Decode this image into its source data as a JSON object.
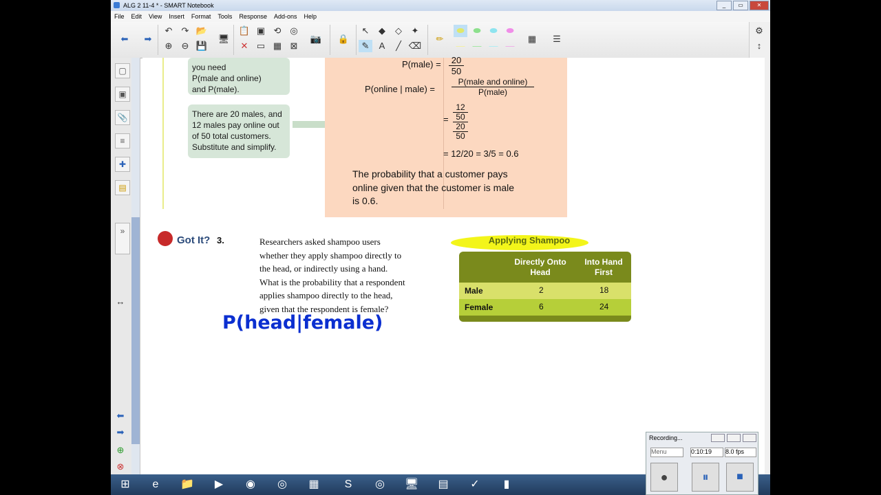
{
  "window": {
    "title": "ALG 2 11-4 * - SMART Notebook"
  },
  "menu": [
    "File",
    "Edit",
    "View",
    "Insert",
    "Format",
    "Tools",
    "Response",
    "Add-ons",
    "Help"
  ],
  "lesson": {
    "box1_text": [
      "you need",
      "P(male and online)",
      "and P(male)."
    ],
    "box2_text": [
      "There are 20 males, and",
      "12 males pay online out",
      "of 50 total customers.",
      "Substitute and simplify."
    ],
    "eq1_left": "P(male) =",
    "eq1_num": "20",
    "eq1_den": "50",
    "eq2_left": "P(online | male) =",
    "eq2_num": "P(male and online)",
    "eq2_den": "P(male)",
    "eq3_a": "12",
    "eq3_b": "50",
    "eq3_c": "20",
    "eq3_d": "50",
    "eq4": "= 12/20 = 3/5 = 0.6",
    "conclusion": [
      "The probability that a customer pays",
      "online given that the customer is male",
      "is 0.6."
    ],
    "got_it": "Got It?",
    "q_number": "3.",
    "question": [
      "Researchers asked shampoo users",
      "whether they apply shampoo directly to",
      "the head, or indirectly using a hand.",
      "What is the probability that a respondent",
      "applies shampoo directly to the head,",
      "given that the respondent is female?"
    ],
    "handwriting": "P(head|female)"
  },
  "table": {
    "title": "Applying Shampoo",
    "col1": "Directly Onto Head",
    "col2": "Into Hand First",
    "rows": [
      {
        "label": "Male",
        "a": "2",
        "b": "18"
      },
      {
        "label": "Female",
        "a": "6",
        "b": "24"
      }
    ]
  },
  "recorder": {
    "title": "Recording...",
    "time": "0:10:19",
    "fps": "8.0 fps",
    "menu": "Menu"
  },
  "colors": {
    "orange_box": "#fcd8c0",
    "green_box": "#d6e6d8",
    "table_olive": "#7a8a1c"
  }
}
